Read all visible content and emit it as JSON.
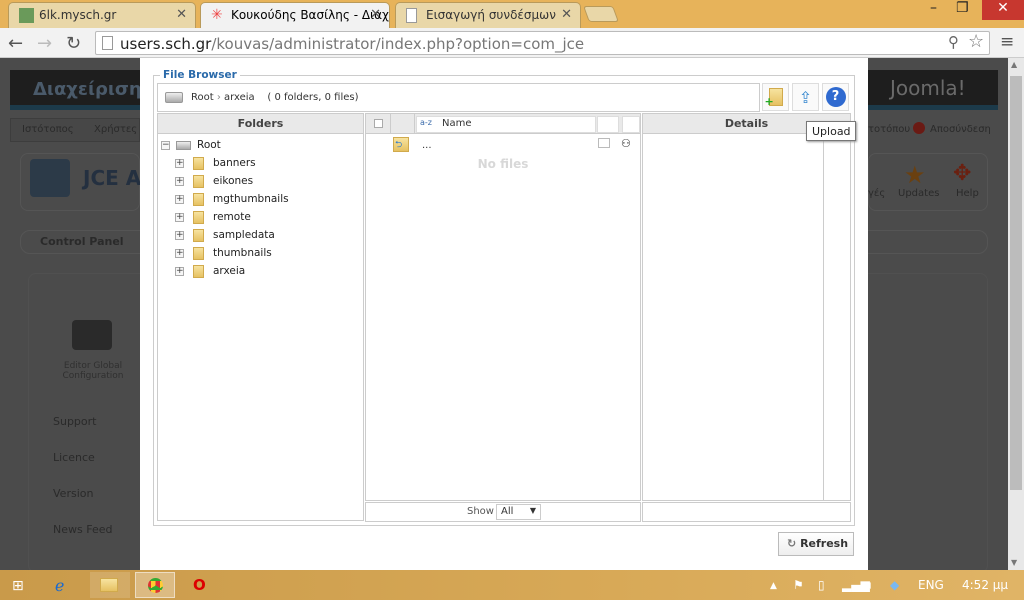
{
  "browser": {
    "tabs": [
      {
        "title": "6lk.mysch.gr",
        "active": false
      },
      {
        "title": "Κουκούδης Βασίλης - Διαχ",
        "active": true
      },
      {
        "title": "Εισαγωγή συνδέσμων",
        "active": false
      }
    ],
    "url_host": "users.sch.gr",
    "url_path": "/kouvas/administrator/index.php?option=com_jce"
  },
  "background_page": {
    "header_title": "Διαχείριση",
    "menu": [
      "Ιστότοπος",
      "Χρήστες"
    ],
    "right_menu": [
      "τοτόπου",
      "Αποσύνδεση"
    ],
    "component_title": "JCE A",
    "control_panel_tab": "Control Panel",
    "quick_icons": [
      {
        "label": "γές"
      },
      {
        "label": "Updates"
      },
      {
        "label": "Help"
      }
    ],
    "editor_config": "Editor Global Configuration",
    "links": [
      "Support",
      "Licence",
      "Version",
      "News Feed"
    ],
    "logo": "Joomla!"
  },
  "file_browser": {
    "legend": "File Browser",
    "breadcrumb_root": "Root",
    "breadcrumb_sep": "›",
    "breadcrumb_current": "arxeia",
    "summary": "( 0 folders, 0 files)",
    "tooltip": "Upload",
    "folders_header": "Folders",
    "name_header": "Name",
    "details_header": "Details",
    "tree_root": "Root",
    "folders": [
      "banners",
      "eikones",
      "mgthumbnails",
      "remote",
      "sampledata",
      "thumbnails",
      "arxeia"
    ],
    "parent_item": "...",
    "empty_text": "No files",
    "show_label": "Show",
    "show_value": "All",
    "refresh_label": "Refresh"
  },
  "taskbar": {
    "language": "ENG",
    "time": "4:52 μμ"
  }
}
